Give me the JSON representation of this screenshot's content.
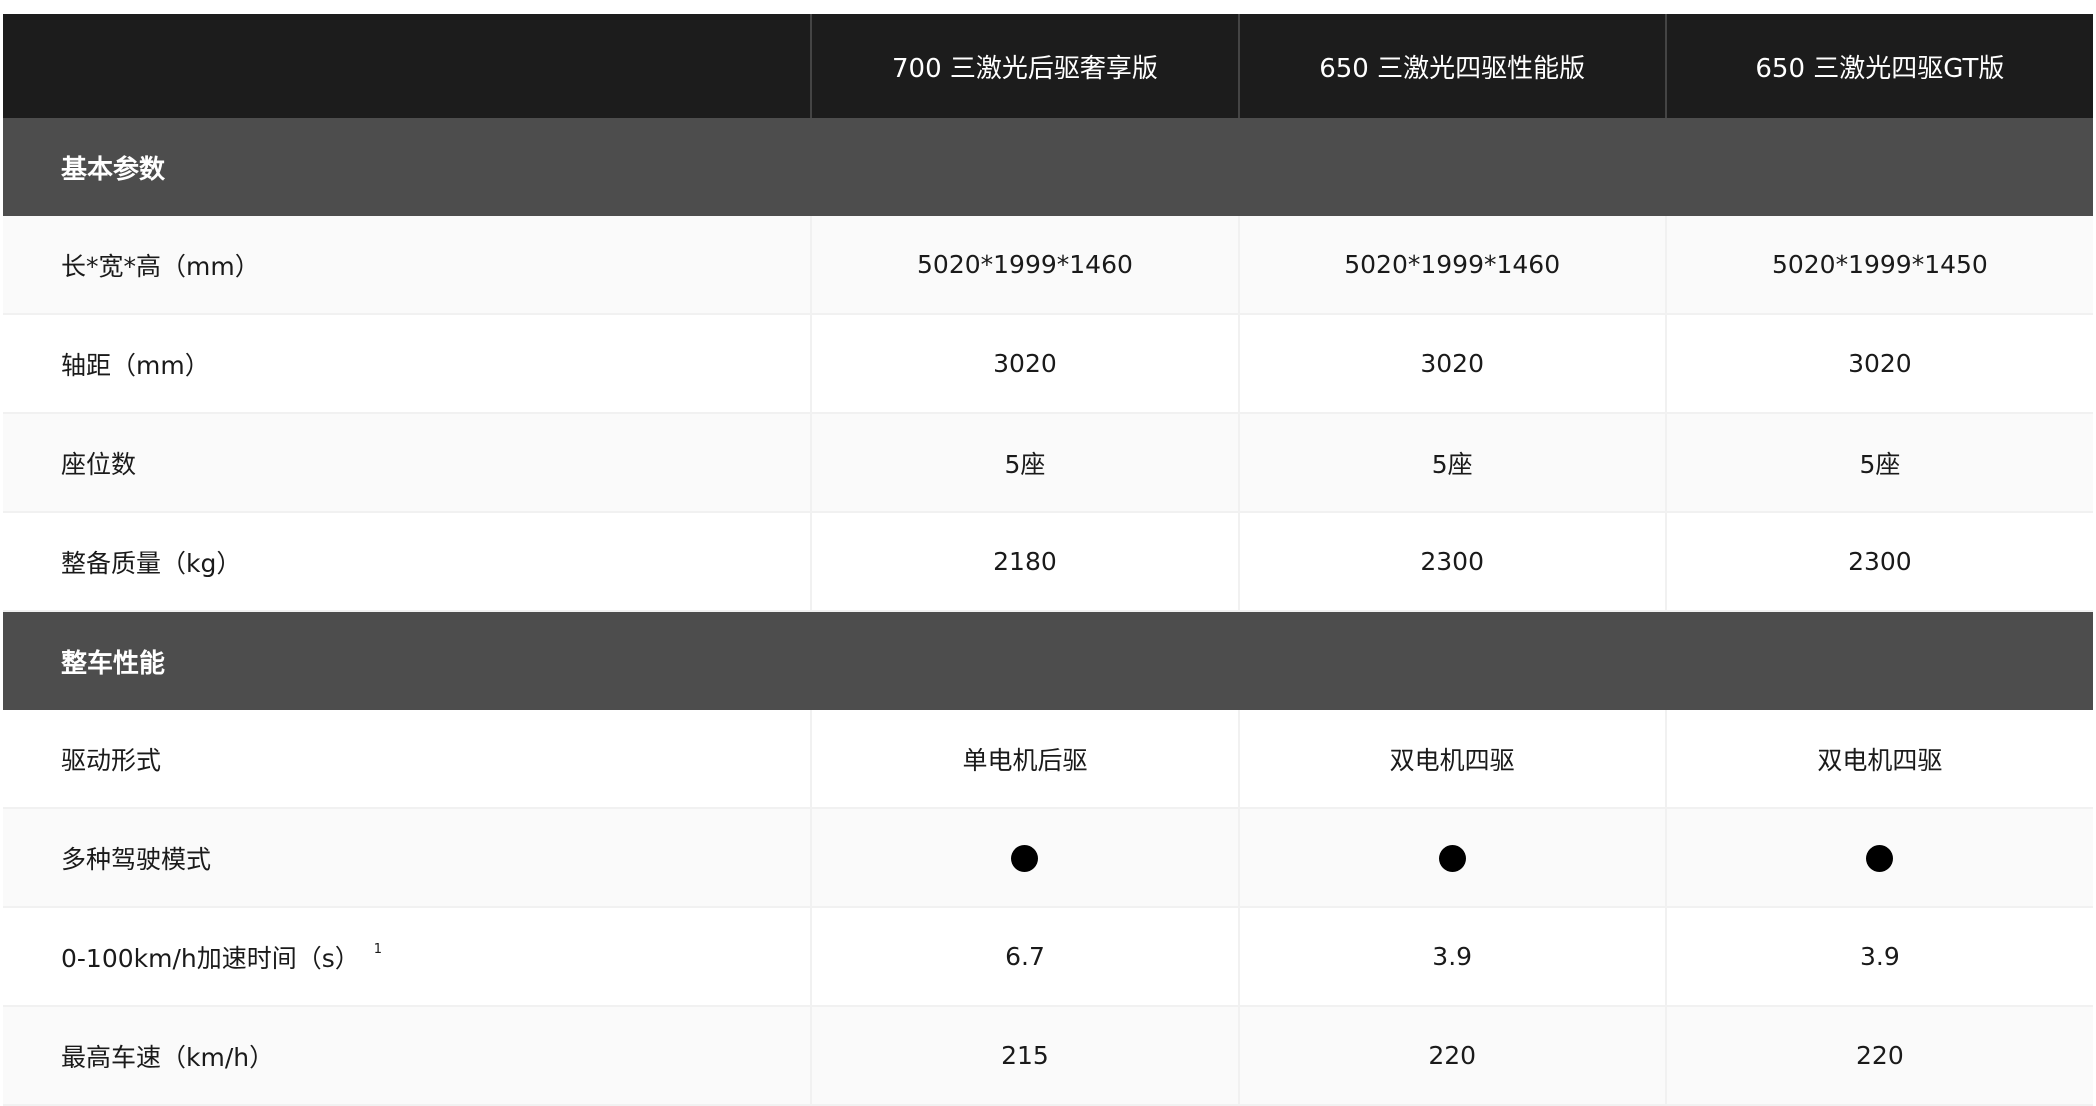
{
  "header": {
    "corner": "",
    "models": [
      "700 三激光后驱奢享版",
      "650 三激光四驱性能版",
      "650 三激光四驱GT版"
    ]
  },
  "sections": [
    {
      "title": "基本参数",
      "rows": [
        {
          "label": "长*宽*高（mm）",
          "values": [
            "5020*1999*1460",
            "5020*1999*1460",
            "5020*1999*1450"
          ]
        },
        {
          "label": "轴距（mm）",
          "values": [
            "3020",
            "3020",
            "3020"
          ]
        },
        {
          "label": "座位数",
          "values": [
            "5座",
            "5座",
            "5座"
          ]
        },
        {
          "label": "整备质量（kg）",
          "values": [
            "2180",
            "2300",
            "2300"
          ]
        }
      ]
    },
    {
      "title": "整车性能",
      "rows": [
        {
          "label": "驱动形式",
          "values": [
            "单电机后驱",
            "双电机四驱",
            "双电机四驱"
          ]
        },
        {
          "label": "多种驾驶模式",
          "values": [
            "●",
            "●",
            "●"
          ],
          "icon": "filled-dot"
        },
        {
          "label": "0-100km/h加速时间（s）",
          "footnote": "1",
          "values": [
            "6.7",
            "3.9",
            "3.9"
          ]
        },
        {
          "label": "最高车速（km/h）",
          "values": [
            "215",
            "220",
            "220"
          ]
        }
      ]
    }
  ]
}
